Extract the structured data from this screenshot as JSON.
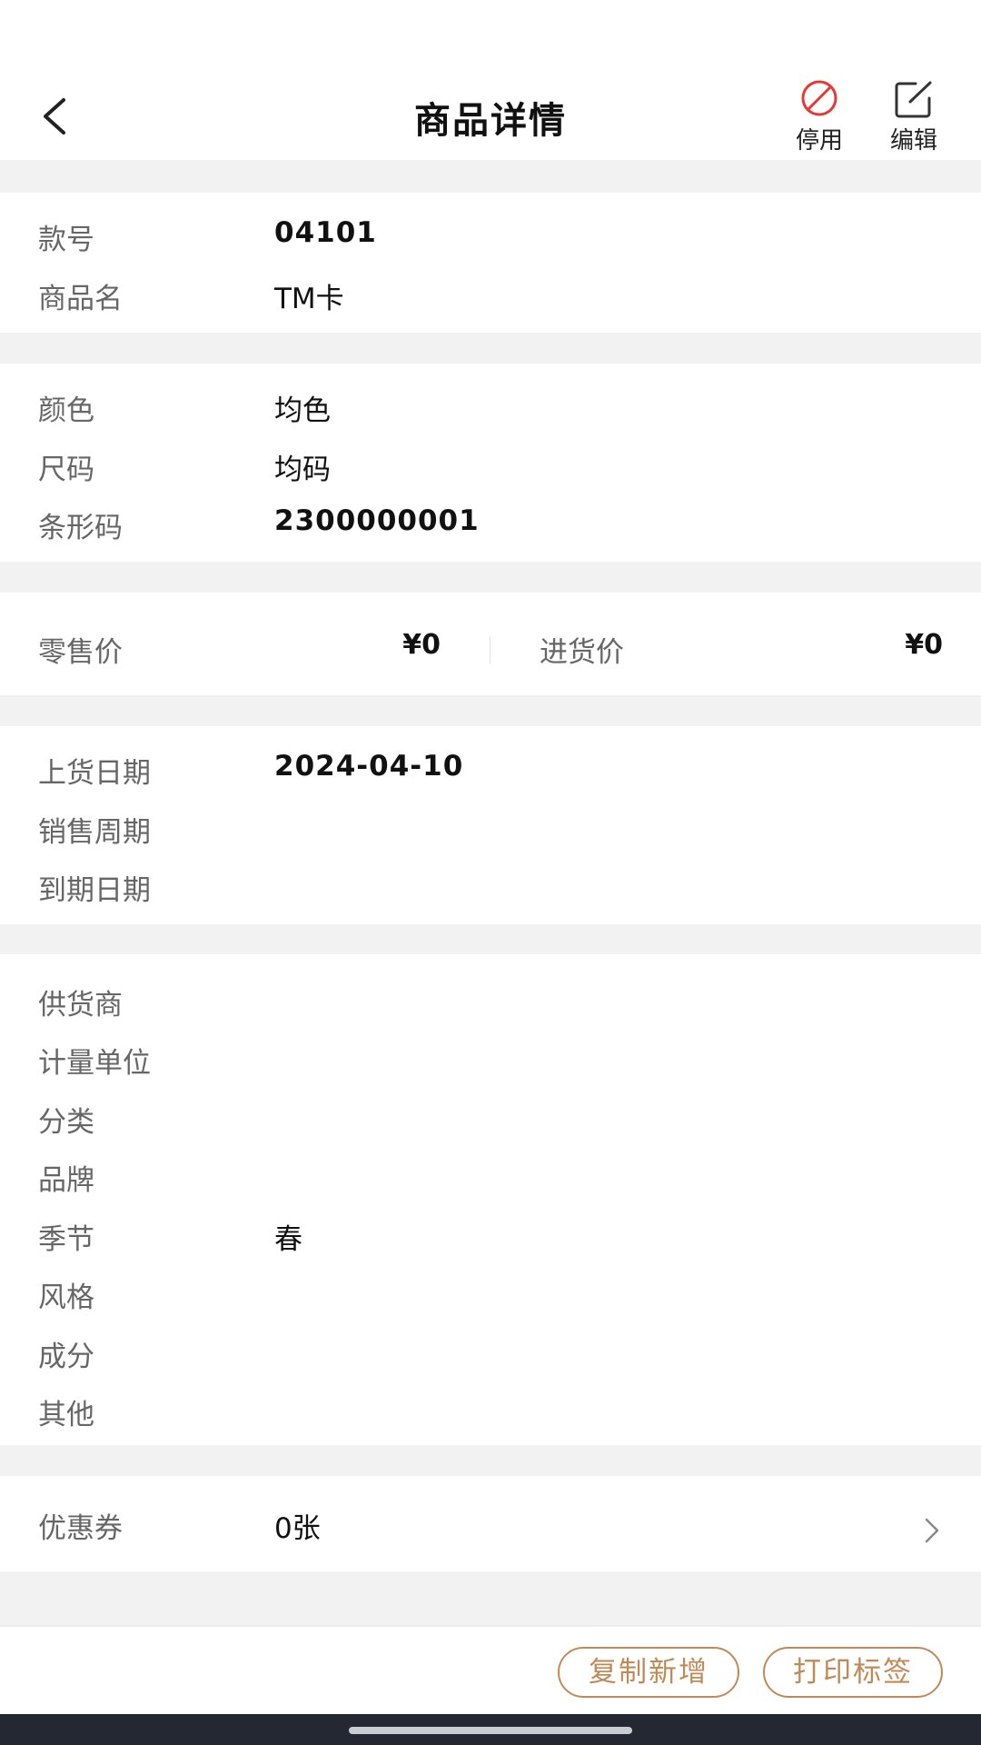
{
  "header": {
    "title": "商品详情",
    "back_icon": "chevron-left-icon",
    "actions": [
      {
        "label": "停用",
        "icon": "disable-icon",
        "color": "#e53935"
      },
      {
        "label": "编辑",
        "icon": "edit-icon",
        "color": "#333333"
      }
    ]
  },
  "basic": {
    "style_no_label": "款号",
    "style_no": "04101",
    "name_label": "商品名",
    "name": "TM卡"
  },
  "sku": {
    "color_label": "颜色",
    "color": "均色",
    "size_label": "尺码",
    "size": "均码",
    "barcode_label": "条形码",
    "barcode": "2300000001"
  },
  "price": {
    "retail_label": "零售价",
    "retail": "¥0",
    "purchase_label": "进货价",
    "purchase": "¥0"
  },
  "dates": {
    "shelf_date_label": "上货日期",
    "shelf_date": "2024-04-10",
    "sales_cycle_label": "销售周期",
    "sales_cycle": "",
    "expiry_label": "到期日期",
    "expiry": ""
  },
  "attributes": {
    "supplier_label": "供货商",
    "supplier": "",
    "unit_label": "计量单位",
    "unit": "",
    "category_label": "分类",
    "category": "",
    "brand_label": "品牌",
    "brand": "",
    "season_label": "季节",
    "season": "春",
    "style_label": "风格",
    "style": "",
    "composition_label": "成分",
    "composition": "",
    "other_label": "其他",
    "other": ""
  },
  "coupon": {
    "label": "优惠券",
    "value": "0张"
  },
  "bottom": {
    "copy_label": "复制新增",
    "print_label": "打印标签",
    "accent": "#c08a57"
  }
}
